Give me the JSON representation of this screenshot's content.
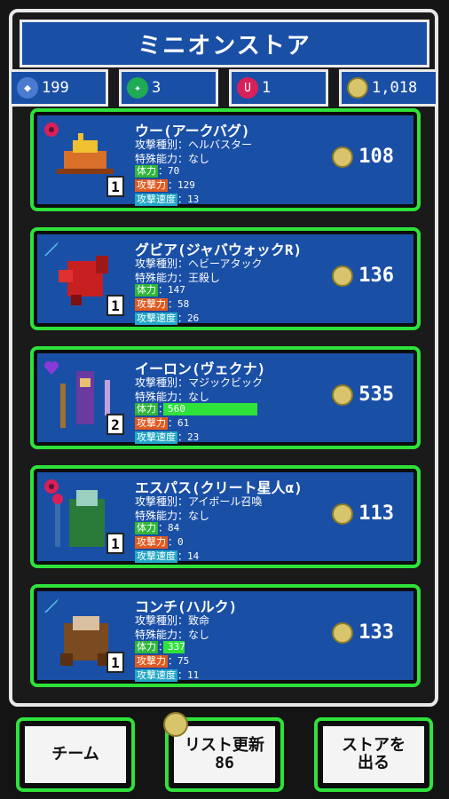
{
  "title": "ミニオンストア",
  "currencies": [
    {
      "icon": "shield-icon",
      "value": "199",
      "color": "#4a7bd0"
    },
    {
      "icon": "green-gem-icon",
      "value": "3",
      "color": "#1faa55"
    },
    {
      "icon": "red-gem-icon",
      "value": "1",
      "color": "#d8205a"
    },
    {
      "icon": "coin-icon",
      "value": "1,018",
      "color": "#d8c46a"
    }
  ],
  "minions": [
    {
      "name": "ウー(アークバグ)",
      "attack_type": "攻撃種別：ヘルバスター",
      "special": "特殊能力：なし",
      "hp_label": "体力",
      "hp": "：70",
      "atk_label": "攻撃力",
      "atk": "：129",
      "spd_label": "攻撃速度",
      "spd": "：13",
      "level": "1",
      "price": "108",
      "type_icon": "flower-icon"
    },
    {
      "name": "グビア(ジャバウォックR)",
      "attack_type": "攻撃種別：ヘビーアタック",
      "special": "特殊能力：王殺し",
      "hp_label": "体力",
      "hp": "：147",
      "atk_label": "攻撃力",
      "atk": "：58",
      "spd_label": "攻撃速度",
      "spd": "：26",
      "level": "1",
      "price": "136",
      "type_icon": "sword-icon"
    },
    {
      "name": "イーロン(ヴェクナ)",
      "attack_type": "攻撃種別：マジックビック",
      "special": "特殊能力：なし",
      "hp_label": "体力",
      "hp": "：560",
      "atk_label": "攻撃力",
      "atk": "：61",
      "spd_label": "攻撃速度",
      "spd": "：23",
      "level": "2",
      "price": "535",
      "type_icon": "heart-icon",
      "hp_fill": 0.52
    },
    {
      "name": "エスパス(クリート星人α)",
      "attack_type": "攻撃種別：アイボール召喚",
      "special": "特殊能力：なし",
      "hp_label": "体力",
      "hp": "：84",
      "atk_label": "攻撃力",
      "atk": "：0",
      "spd_label": "攻撃速度",
      "spd": "：14",
      "level": "1",
      "price": "113",
      "type_icon": "flower-icon"
    },
    {
      "name": "コンチ(ハルク)",
      "attack_type": "攻撃種別：致命",
      "special": "特殊能力：なし",
      "hp_label": "体力",
      "hp": "：337",
      "atk_label": "攻撃力",
      "atk": "：75",
      "spd_label": "攻撃速度",
      "spd": "：11",
      "level": "1",
      "price": "133",
      "type_icon": "sword-icon",
      "hp_fill": 0.12
    }
  ],
  "buttons": {
    "team": "チーム",
    "refresh_line1": "リスト更新",
    "refresh_line2": "86",
    "exit_line1": "ストアを",
    "exit_line2": "出る"
  }
}
